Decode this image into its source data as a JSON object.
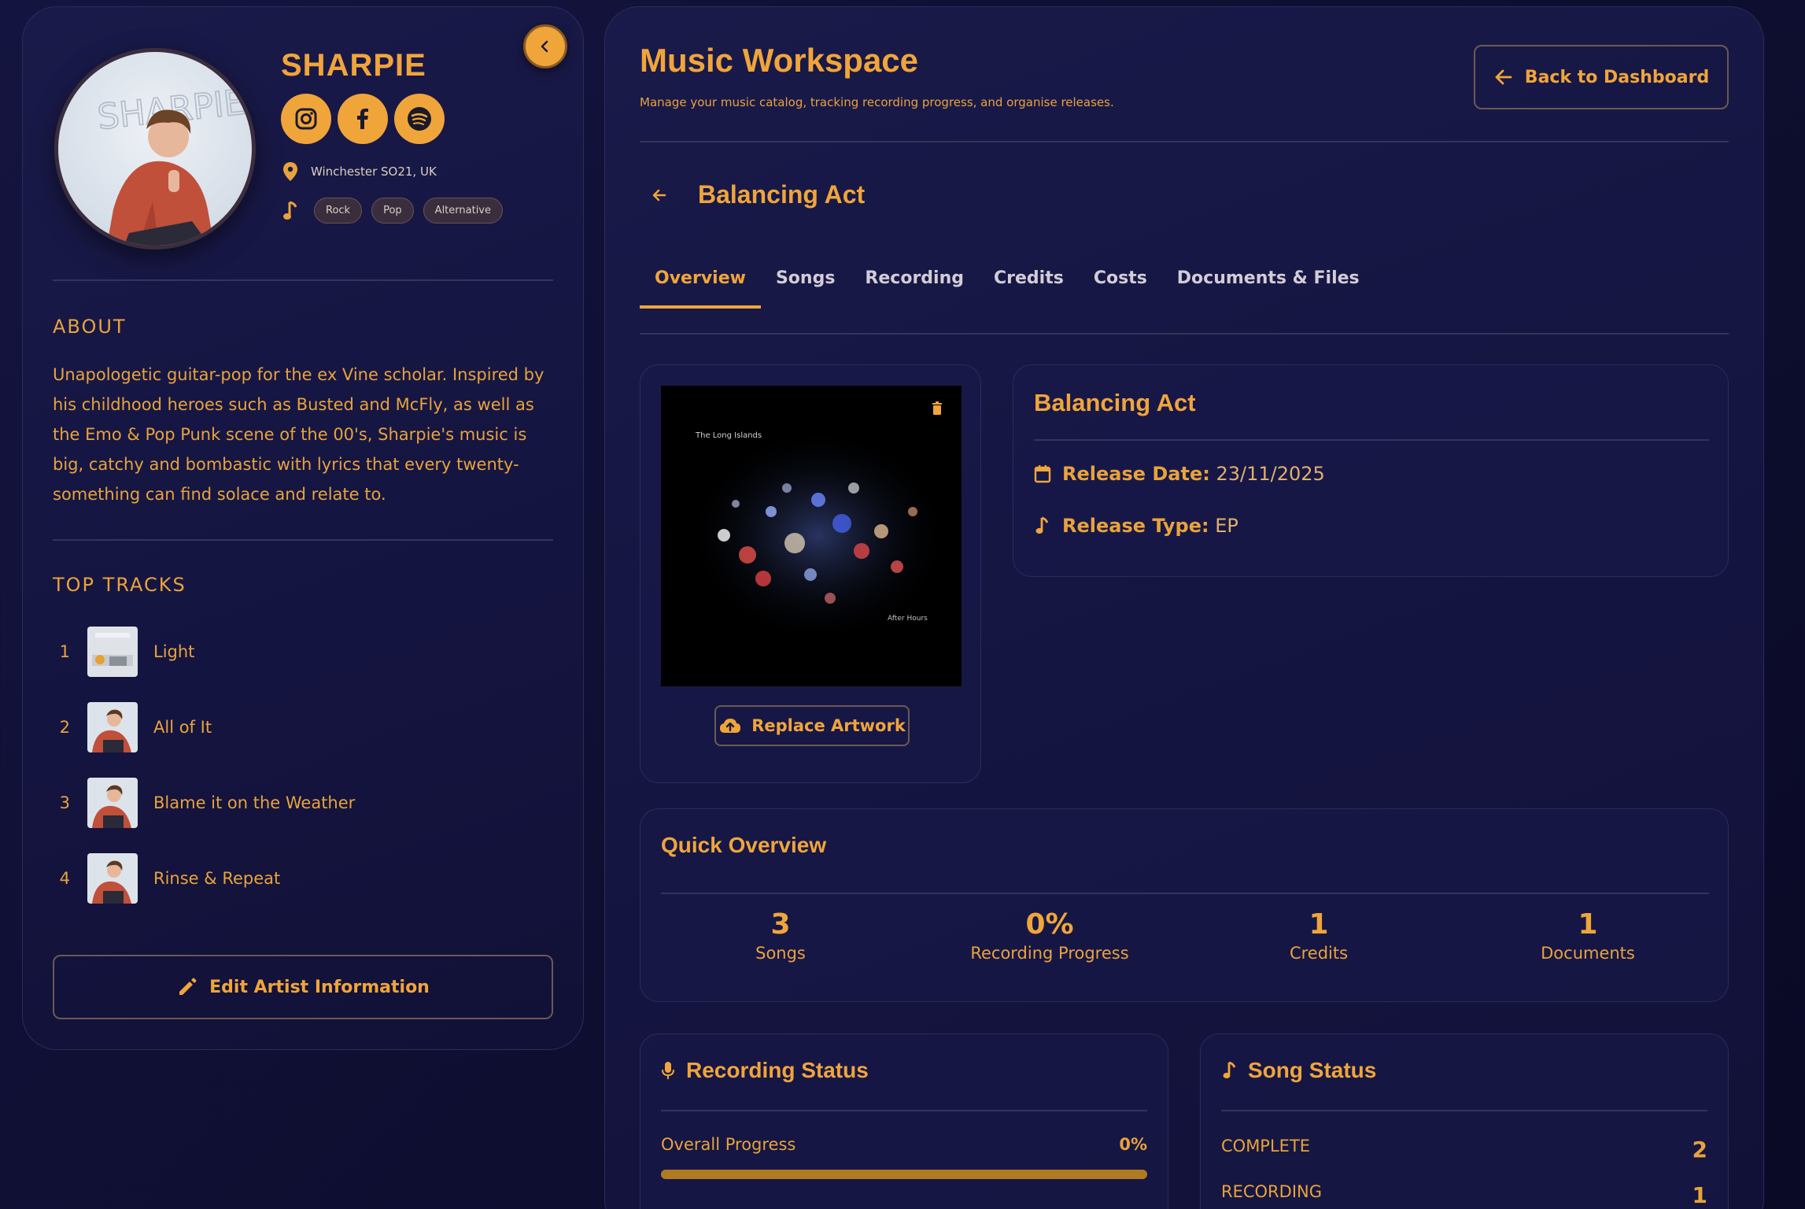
{
  "artist": {
    "name": "SHARPIE",
    "location": "Winchester SO21, UK",
    "genres": [
      "Rock",
      "Pop",
      "Alternative"
    ],
    "socials": [
      "instagram-icon",
      "facebook-icon",
      "spotify-icon"
    ],
    "about_heading": "ABOUT",
    "about_text": "Unapologetic guitar-pop for the ex Vine scholar. Inspired by his childhood heroes such as Busted and McFly, as well as the Emo & Pop Punk scene of the 00's, Sharpie's music is big, catchy and bombastic with lyrics that every twenty-something can find solace and relate to.",
    "top_tracks_heading": "TOP TRACKS",
    "top_tracks": [
      {
        "num": "1",
        "title": "Light"
      },
      {
        "num": "2",
        "title": "All of It"
      },
      {
        "num": "3",
        "title": "Blame it on the Weather"
      },
      {
        "num": "4",
        "title": "Rinse & Repeat"
      }
    ],
    "edit_label": "Edit Artist Information"
  },
  "workspace": {
    "title": "Music Workspace",
    "subtitle": "Manage your music catalog, tracking recording progress, and organise releases.",
    "back_label": "Back to Dashboard",
    "release_title": "Balancing Act",
    "tabs": [
      "Overview",
      "Songs",
      "Recording",
      "Credits",
      "Costs",
      "Documents & Files"
    ],
    "active_tab": "Overview"
  },
  "release": {
    "artwork_text_top": "The Long Islands",
    "artwork_text_bottom": "After Hours",
    "replace_label": "Replace Artwork",
    "title": "Balancing Act",
    "release_date_label": "Release Date:",
    "release_date": "23/11/2025",
    "release_type_label": "Release Type:",
    "release_type": "EP"
  },
  "quick_overview": {
    "title": "Quick Overview",
    "stats": [
      {
        "value": "3",
        "label": "Songs"
      },
      {
        "value": "0%",
        "label": "Recording Progress"
      },
      {
        "value": "1",
        "label": "Credits"
      },
      {
        "value": "1",
        "label": "Documents"
      }
    ]
  },
  "recording_status": {
    "title": "Recording Status",
    "progress_label": "Overall Progress",
    "progress_value": "0%",
    "progress_fraction": 1.0
  },
  "song_status": {
    "title": "Song Status",
    "rows": [
      {
        "label": "COMPLETE",
        "count": "2"
      },
      {
        "label": "RECORDING",
        "count": "1"
      }
    ]
  },
  "colors": {
    "accent": "#f0a53a",
    "background": "#141440",
    "panel_border": "#2c2c5c"
  }
}
